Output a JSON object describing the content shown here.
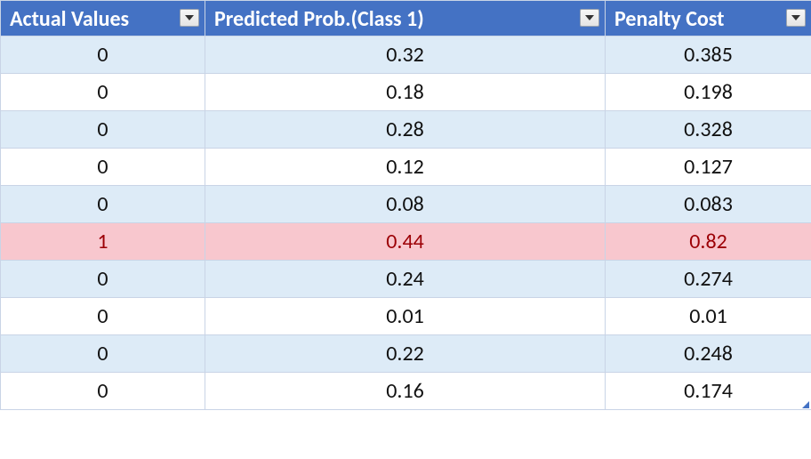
{
  "chart_data": {
    "type": "table",
    "columns": [
      "Actual Values",
      "Predicted Prob.(Class 1)",
      "Penalty Cost"
    ],
    "rows": [
      {
        "actual": "0",
        "predicted": "0.32",
        "penalty": "0.385",
        "style": "band"
      },
      {
        "actual": "0",
        "predicted": "0.18",
        "penalty": "0.198",
        "style": "plain"
      },
      {
        "actual": "0",
        "predicted": "0.28",
        "penalty": "0.328",
        "style": "band"
      },
      {
        "actual": "0",
        "predicted": "0.12",
        "penalty": "0.127",
        "style": "plain"
      },
      {
        "actual": "0",
        "predicted": "0.08",
        "penalty": "0.083",
        "style": "band"
      },
      {
        "actual": "1",
        "predicted": "0.44",
        "penalty": "0.82",
        "style": "highlight"
      },
      {
        "actual": "0",
        "predicted": "0.24",
        "penalty": "0.274",
        "style": "band"
      },
      {
        "actual": "0",
        "predicted": "0.01",
        "penalty": "0.01",
        "style": "plain"
      },
      {
        "actual": "0",
        "predicted": "0.22",
        "penalty": "0.248",
        "style": "band"
      },
      {
        "actual": "0",
        "predicted": "0.16",
        "penalty": "0.174",
        "style": "plain"
      }
    ]
  },
  "headers": {
    "col_a": "Actual Values",
    "col_b": "Predicted Prob.(Class 1)",
    "col_c": "Penalty Cost"
  }
}
